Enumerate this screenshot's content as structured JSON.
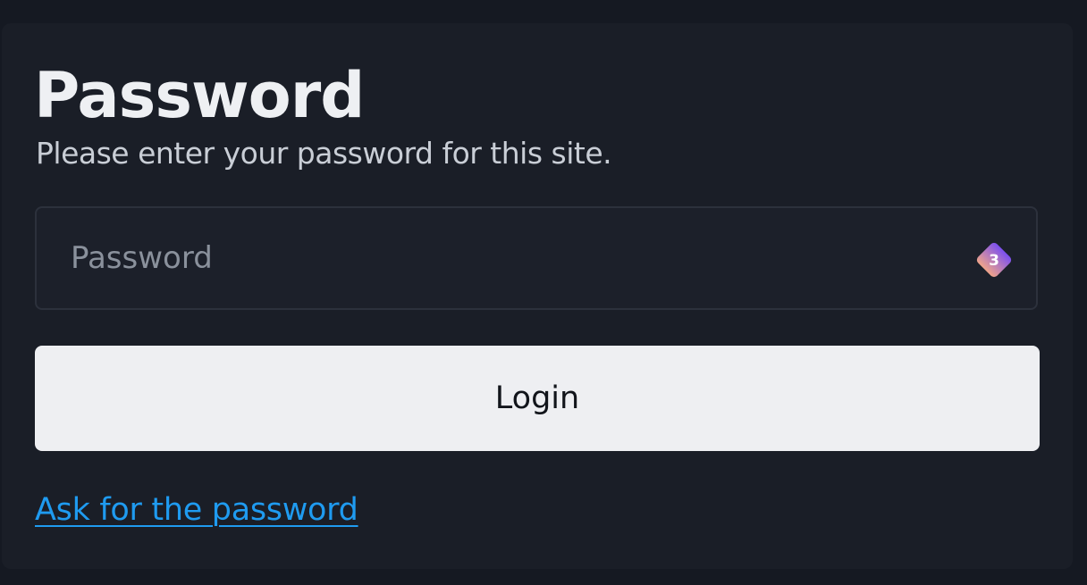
{
  "page": {
    "title": "Password",
    "subtitle": "Please enter your password for this site."
  },
  "password_field": {
    "placeholder": "Password",
    "value": ""
  },
  "extension_badge": {
    "icon": "password-manager-icon",
    "count": "3",
    "colors": [
      "#7b4ff0",
      "#f0a58a"
    ]
  },
  "login_button": {
    "label": "Login"
  },
  "help_link": {
    "label": "Ask for the password"
  },
  "colors": {
    "background": "#151922",
    "card": "#1a1e27",
    "link": "#1f9bf0",
    "button": "#eeeff2"
  }
}
